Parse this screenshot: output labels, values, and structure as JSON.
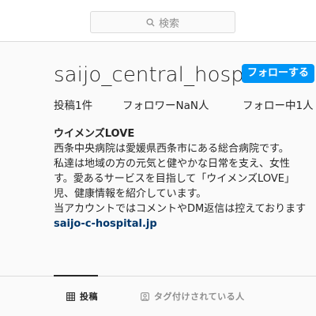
{
  "search": {
    "placeholder": "検索",
    "icon": "search-icon"
  },
  "profile": {
    "username": "saijo_central_hospital",
    "follow_label": "フォローする",
    "stats": {
      "posts": "投稿1件",
      "followers": "フォロワーNaN人",
      "following": "フォロー中1人"
    },
    "bio": {
      "name": "ウイメンズLOVE",
      "lines": [
        "西条中央病院は愛媛県西条市にある総合病院です。",
        "私達は地域の方の元気と健やかな日常を支え、女性",
        "す。愛あるサービスを目指して「ウイメンズLOVE」",
        "児、健康情報を紹介しています。",
        "当アカウントではコメントやDM返信は控えております"
      ],
      "link": "saijo-c-hospital.jp"
    }
  },
  "tabs": [
    {
      "label": "投稿",
      "icon": "grid-icon",
      "active": true
    },
    {
      "label": "タグ付けされている人",
      "icon": "tagged-user-icon",
      "active": false
    }
  ],
  "colors": {
    "accent": "#0095f6",
    "link": "#00376b",
    "text": "#262626",
    "muted": "#8e8e8e"
  }
}
